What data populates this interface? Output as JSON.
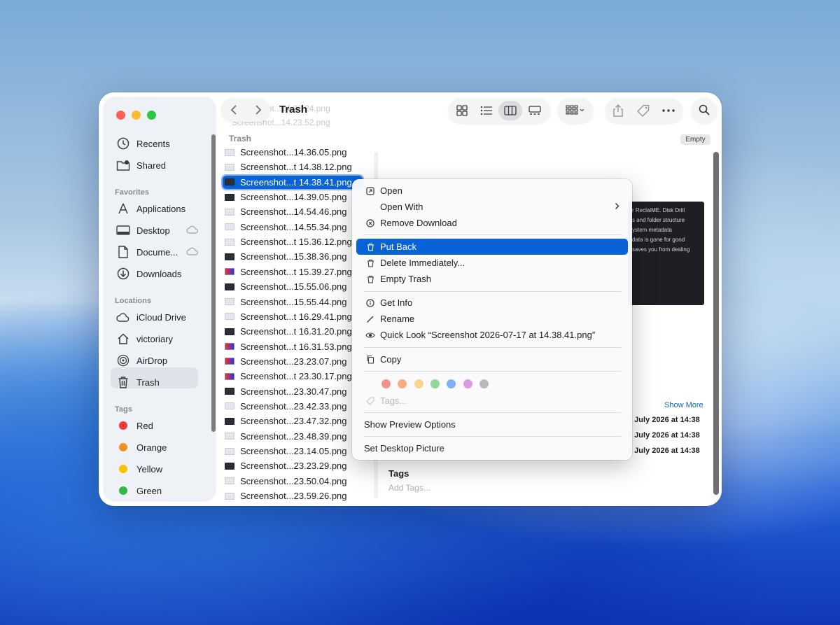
{
  "window": {
    "title": "Trash",
    "ghost_files": [
      "Screenshot...14.23.24.png",
      "Screenshot...14.23.52.png"
    ]
  },
  "sidebar": {
    "top_items": [
      {
        "label": "Recents",
        "icon": "clock-icon"
      },
      {
        "label": "Shared",
        "icon": "shared-folder-icon"
      }
    ],
    "favorites_header": "Favorites",
    "favorites": [
      {
        "label": "Applications",
        "icon": "applications-icon"
      },
      {
        "label": "Desktop",
        "icon": "desktop-icon"
      },
      {
        "label": "Docume...",
        "icon": "document-icon"
      },
      {
        "label": "Downloads",
        "icon": "downloads-icon"
      }
    ],
    "locations_header": "Locations",
    "locations": [
      {
        "label": "iCloud Drive",
        "icon": "cloud-icon"
      },
      {
        "label": "victoriary",
        "icon": "home-icon"
      },
      {
        "label": "AirDrop",
        "icon": "airdrop-icon"
      },
      {
        "label": "Trash",
        "icon": "trash-icon"
      }
    ],
    "tags_header": "Tags",
    "tags": [
      {
        "label": "Red",
        "color": "#ee3b3b"
      },
      {
        "label": "Orange",
        "color": "#f5901e"
      },
      {
        "label": "Yellow",
        "color": "#f5c400"
      },
      {
        "label": "Green",
        "color": "#2db843"
      }
    ]
  },
  "column": {
    "header": "Trash",
    "files": [
      "Screenshot...14.36.05.png",
      "Screenshot...t 14.38.12.png",
      "Screenshot...t 14.38.41.png",
      "Screenshot...14.39.05.png",
      "Screenshot...14.54.46.png",
      "Screenshot...14.55.34.png",
      "Screenshot...t 15.36.12.png",
      "Screenshot...15.38.36.png",
      "Screenshot...t 15.39.27.png",
      "Screenshot...15.55.06.png",
      "Screenshot...15.55.44.png",
      "Screenshot...t 16.29.41.png",
      "Screenshot...t 16.31.20.png",
      "Screenshot...t 16.31.53.png",
      "Screenshot...23.23.07.png",
      "Screenshot...t 23.30.17.png",
      "Screenshot...23.30.47.png",
      "Screenshot...23.42.33.png",
      "Screenshot...23.47.32.png",
      "Screenshot...23.48.39.png",
      "Screenshot...23.14.05.png",
      "Screenshot...23.23.29.png",
      "Screenshot...23.50.04.png",
      "Screenshot...23.59.26.png"
    ],
    "selected_index": 2
  },
  "preview": {
    "empty_button": "Empty",
    "image_text": [
      "r ReclaiME. Disk Drill",
      "s and folder structure",
      "",
      "ystem metadata",
      "data is gone for good",
      "",
      "saves you from dealing"
    ],
    "show_more": "Show More",
    "dates": [
      "7 July 2026 at 14:38",
      "7 July 2026 at 14:38",
      "7 July 2026 at 14:38"
    ],
    "tags_label": "Tags",
    "add_tags_placeholder": "Add Tags..."
  },
  "context_menu": {
    "open": "Open",
    "open_with": "Open With",
    "remove_download": "Remove Download",
    "put_back": "Put Back",
    "delete_immediately": "Delete Immediately...",
    "empty_trash": "Empty Trash",
    "get_info": "Get Info",
    "rename": "Rename",
    "quick_look": "Quick Look “Screenshot 2026-07-17 at 14.38.41.png”",
    "copy": "Copy",
    "tag_colors": [
      "#f2948c",
      "#f5ad88",
      "#f7d58a",
      "#93d69a",
      "#7db3f2",
      "#d99be3",
      "#b9b9bd"
    ],
    "tags": "Tags...",
    "show_preview_options": "Show Preview Options",
    "set_desktop_picture": "Set Desktop Picture"
  }
}
